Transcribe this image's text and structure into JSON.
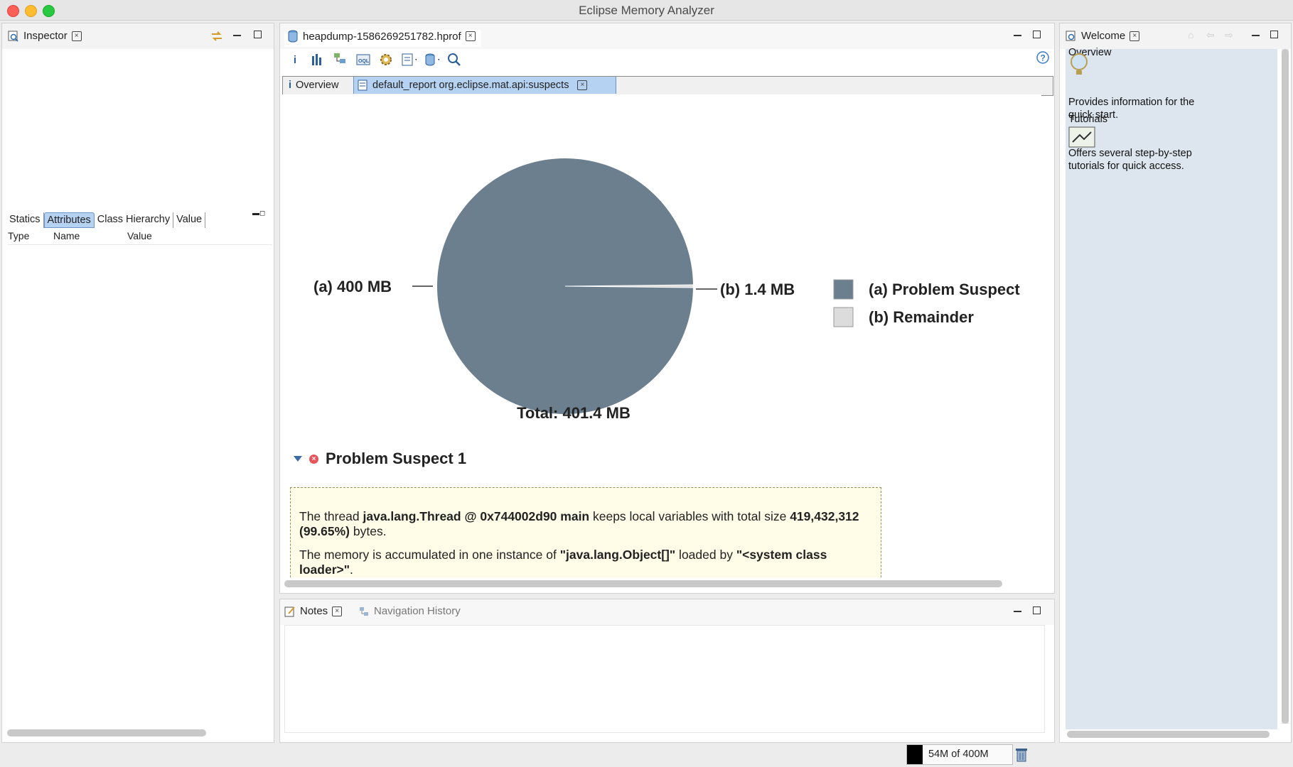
{
  "window": {
    "title": "Eclipse Memory Analyzer"
  },
  "inspector": {
    "tab_label": "Inspector",
    "tabs": [
      "Statics",
      "Attributes",
      "Class Hierarchy",
      "Value"
    ],
    "columns": [
      "Type",
      "Name",
      "Value"
    ]
  },
  "editor": {
    "tab_label": "heapdump-1586269251782.hprof",
    "subtabs": {
      "overview": "Overview",
      "report": "default_report  org.eclipse.mat.api:suspects"
    },
    "chart_total": "Total: 401.4 MB",
    "suspect": {
      "title": "Problem Suspect 1",
      "p1_a": "The thread ",
      "p1_b": "java.lang.Thread @ 0x744002d90 main",
      "p1_c": " keeps local variables with total size ",
      "p1_d": "419,432,312 (99.65%)",
      "p1_e": " bytes.",
      "p2_a": "The memory is accumulated in one instance of ",
      "p2_b": "\"java.lang.Object[]\"",
      "p2_c": " loaded by ",
      "p2_d": "\"<system class loader>\"",
      "p2_e": "."
    }
  },
  "chart_data": {
    "type": "pie",
    "categories": [
      "(a) Problem Suspect",
      "(b) Remainder"
    ],
    "values": [
      400,
      1.4
    ],
    "slice_labels": [
      "(a)  400 MB",
      "(b)  1.4 MB"
    ],
    "legend": [
      {
        "key": "(a)",
        "label": "Problem Suspect",
        "color": "#6b7f8f"
      },
      {
        "key": "(b)",
        "label": "Remainder",
        "color": "#dcdcdc"
      }
    ],
    "legend_position": "right",
    "total_label": "Total: 401.4 MB"
  },
  "notes": {
    "tab_label": "Notes",
    "history_label": "Navigation History"
  },
  "welcome": {
    "tab_label": "Welcome",
    "overview_title": "Overview",
    "overview_desc": "Provides information for the quick start.",
    "tutorials_title": "Tutorials",
    "tutorials_desc": "Offers several step-by-step tutorials for quick access."
  },
  "status": {
    "memory": "54M of 400M"
  },
  "colors": {
    "suspect": "#6b7f8f",
    "remainder": "#dcdcdc",
    "active_tab": "#b6d2f2",
    "welcome_bg": "#dde6ef",
    "suspect_box": "#fffde7"
  }
}
